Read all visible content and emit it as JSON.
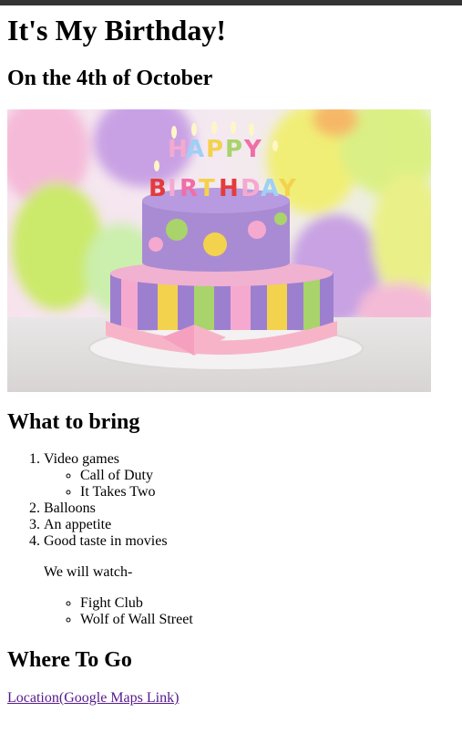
{
  "page": {
    "title": "It's My Birthday!",
    "date_heading": "On the 4th of October"
  },
  "image": {
    "alt": "birthday-cake",
    "cake_topper_lines": [
      "HAPPY",
      "BIRTHDAY"
    ],
    "colors": {
      "cake_top": "#a98bd4",
      "cake_bottom": "#9d7fd0",
      "stripe_pink": "#f5a9cf",
      "stripe_yellow": "#f3d24e",
      "stripe_green": "#a9d36b",
      "ribbon": "#f7b4c8"
    }
  },
  "bring": {
    "heading": "What to bring",
    "items": [
      {
        "label": "Video games",
        "sub": [
          "Call of Duty",
          "It Takes Two"
        ]
      },
      {
        "label": "Balloons"
      },
      {
        "label": "An appetite"
      },
      {
        "label": "Good taste in movies",
        "note": "We will watch-",
        "sub": [
          "Fight Club",
          "Wolf of Wall Street"
        ]
      }
    ]
  },
  "where": {
    "heading": "Where To Go",
    "link_text": "Location(Google Maps Link)",
    "link_color": "#551a8b"
  }
}
